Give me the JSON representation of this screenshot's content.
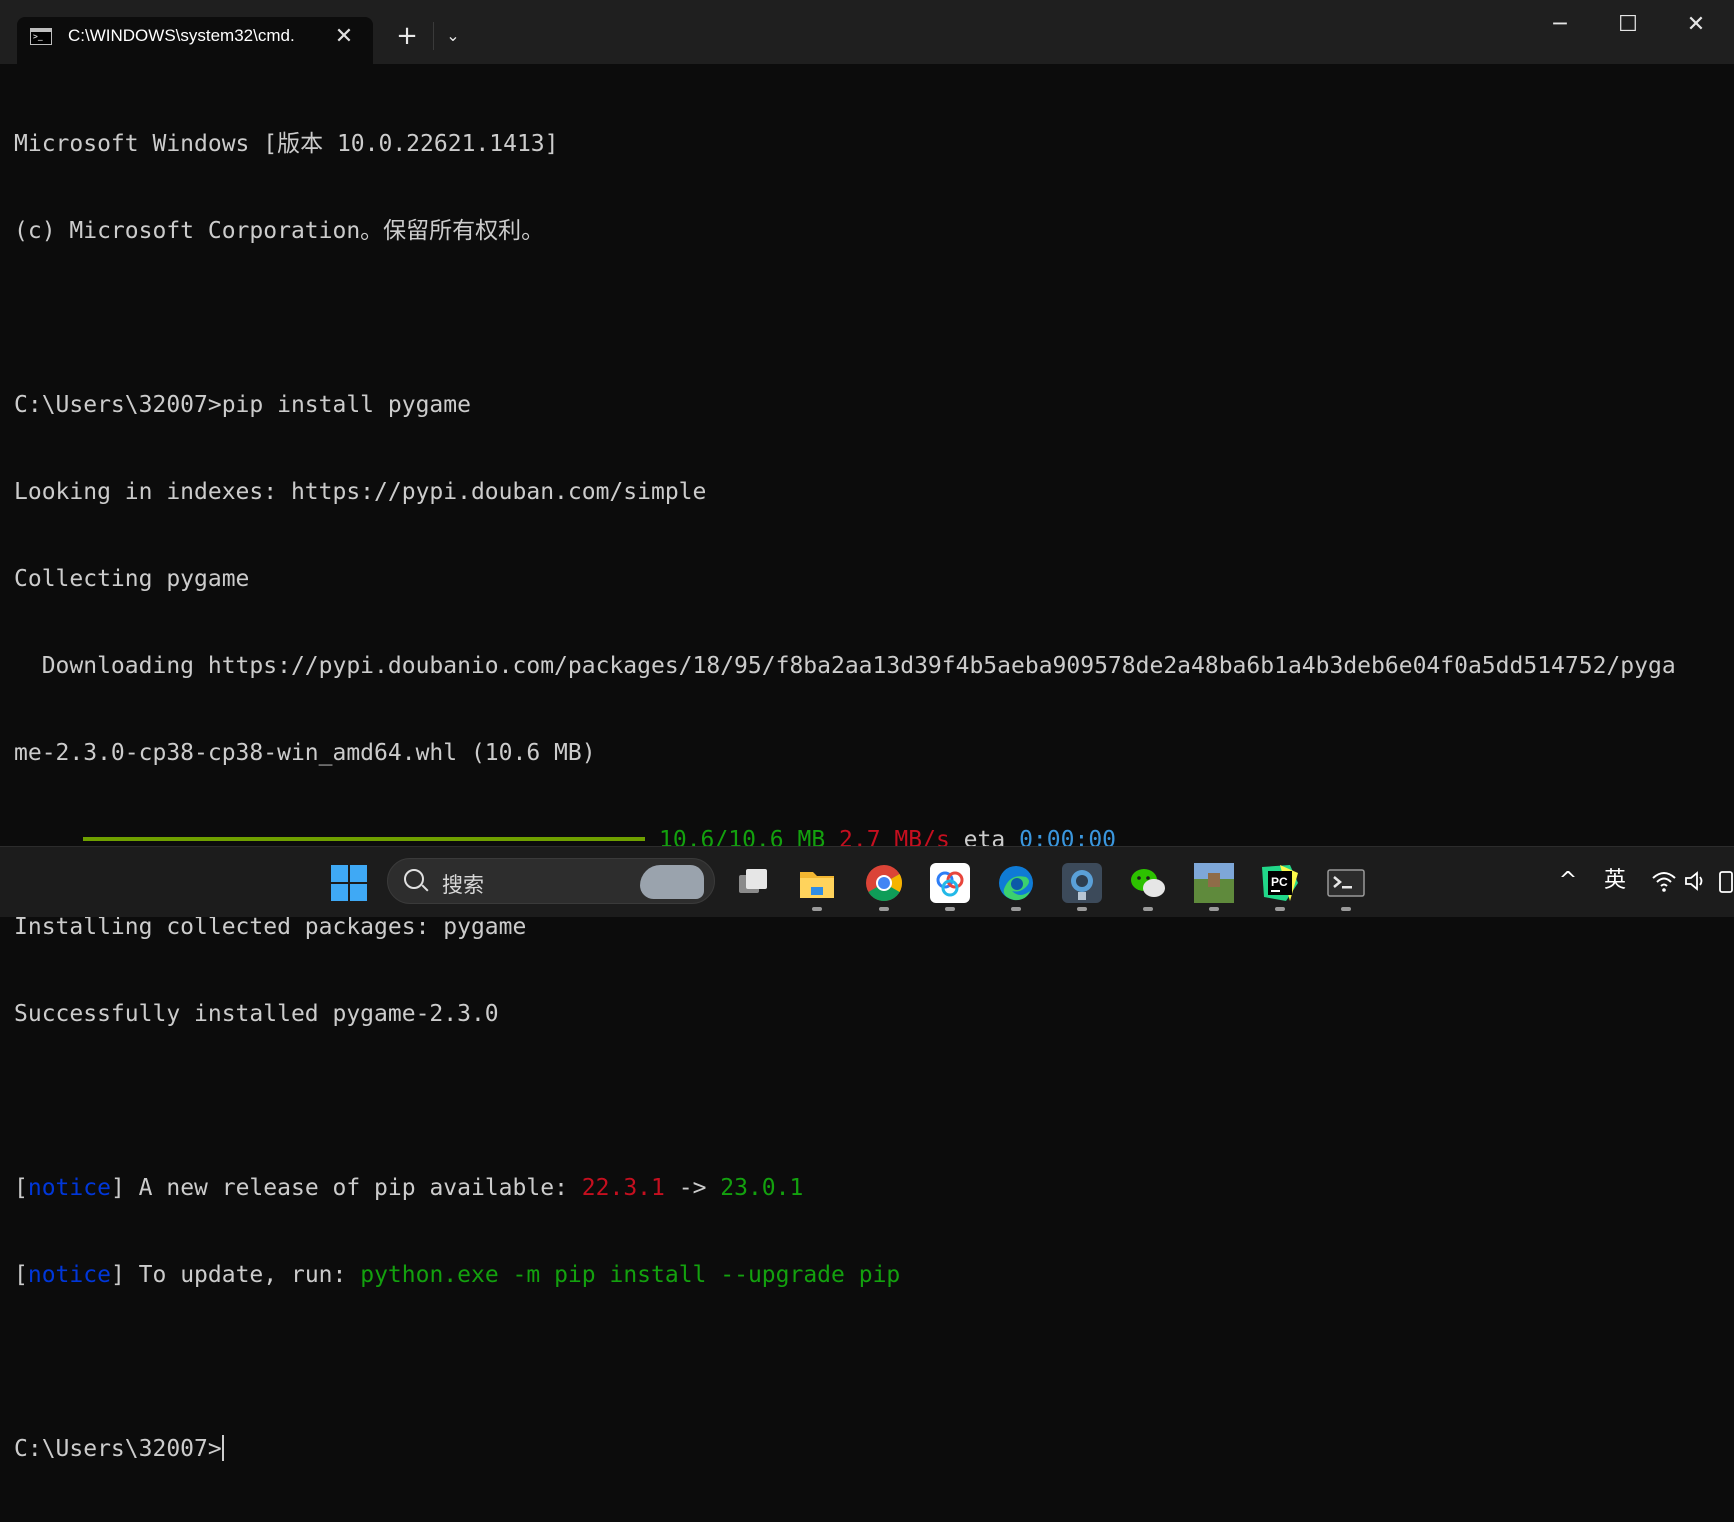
{
  "window": {
    "tab_title": "C:\\WINDOWS\\system32\\cmd.",
    "tab_close_glyph": "✕",
    "new_tab_glyph": "+",
    "dropdown_glyph": "⌄",
    "minimize_glyph": "─",
    "maximize_glyph": "☐",
    "close_glyph": "✕"
  },
  "console": {
    "banner_1": "Microsoft Windows [版本 10.0.22621.1413]",
    "banner_2": "(c) Microsoft Corporation。保留所有权利。",
    "cmd_1": "C:\\Users\\32007>pip install pygame",
    "out_1": "Looking in indexes: https://pypi.douban.com/simple",
    "out_2": "Collecting pygame",
    "out_3": "  Downloading https://pypi.doubanio.com/packages/18/95/f8ba2aa13d39f4b5aeba909578de2a48ba6b1a4b3deb6e04f0a5dd514752/pyga",
    "out_4": "me-2.3.0-cp38-cp38-win_amd64.whl (10.6 MB)",
    "progress": {
      "fraction": 1.0,
      "size": "10.6/10.6 MB",
      "speed": "2.7 MB/s",
      "eta_label": "eta",
      "eta": "0:00:00"
    },
    "out_5": "Installing collected packages: pygame",
    "out_6": "Successfully installed pygame-2.3.0",
    "notice_1": {
      "open": "[",
      "tag": "notice",
      "close": "]",
      "text": " A new release of pip available: ",
      "old_version": "22.3.1",
      "arrow": " -> ",
      "new_version": "23.0.1"
    },
    "notice_2": {
      "open": "[",
      "tag": "notice",
      "close": "]",
      "text": " To update, run: ",
      "command": "python.exe -m pip install --upgrade pip"
    },
    "prompt": "C:\\Users\\32007>"
  },
  "taskbar": {
    "search_placeholder": "搜索",
    "apps": [
      "start-icon",
      "task-view-icon",
      "file-explorer-icon",
      "chrome-icon",
      "baidu-netdisk-icon",
      "edge-icon",
      "photo-viewer-icon",
      "wechat-icon",
      "minecraft-icon",
      "pycharm-icon",
      "terminal-icon"
    ],
    "tray": {
      "chevron": "^",
      "ime": "英",
      "wifi": "wifi",
      "volume": "volume"
    }
  },
  "colors": {
    "console_bg": "#0c0c0c",
    "text": "#cccccc",
    "green": "#13a10e",
    "red": "#c50f1f",
    "blue": "#0037da",
    "cyan": "#3a96dd",
    "progress": "#6fa000"
  }
}
